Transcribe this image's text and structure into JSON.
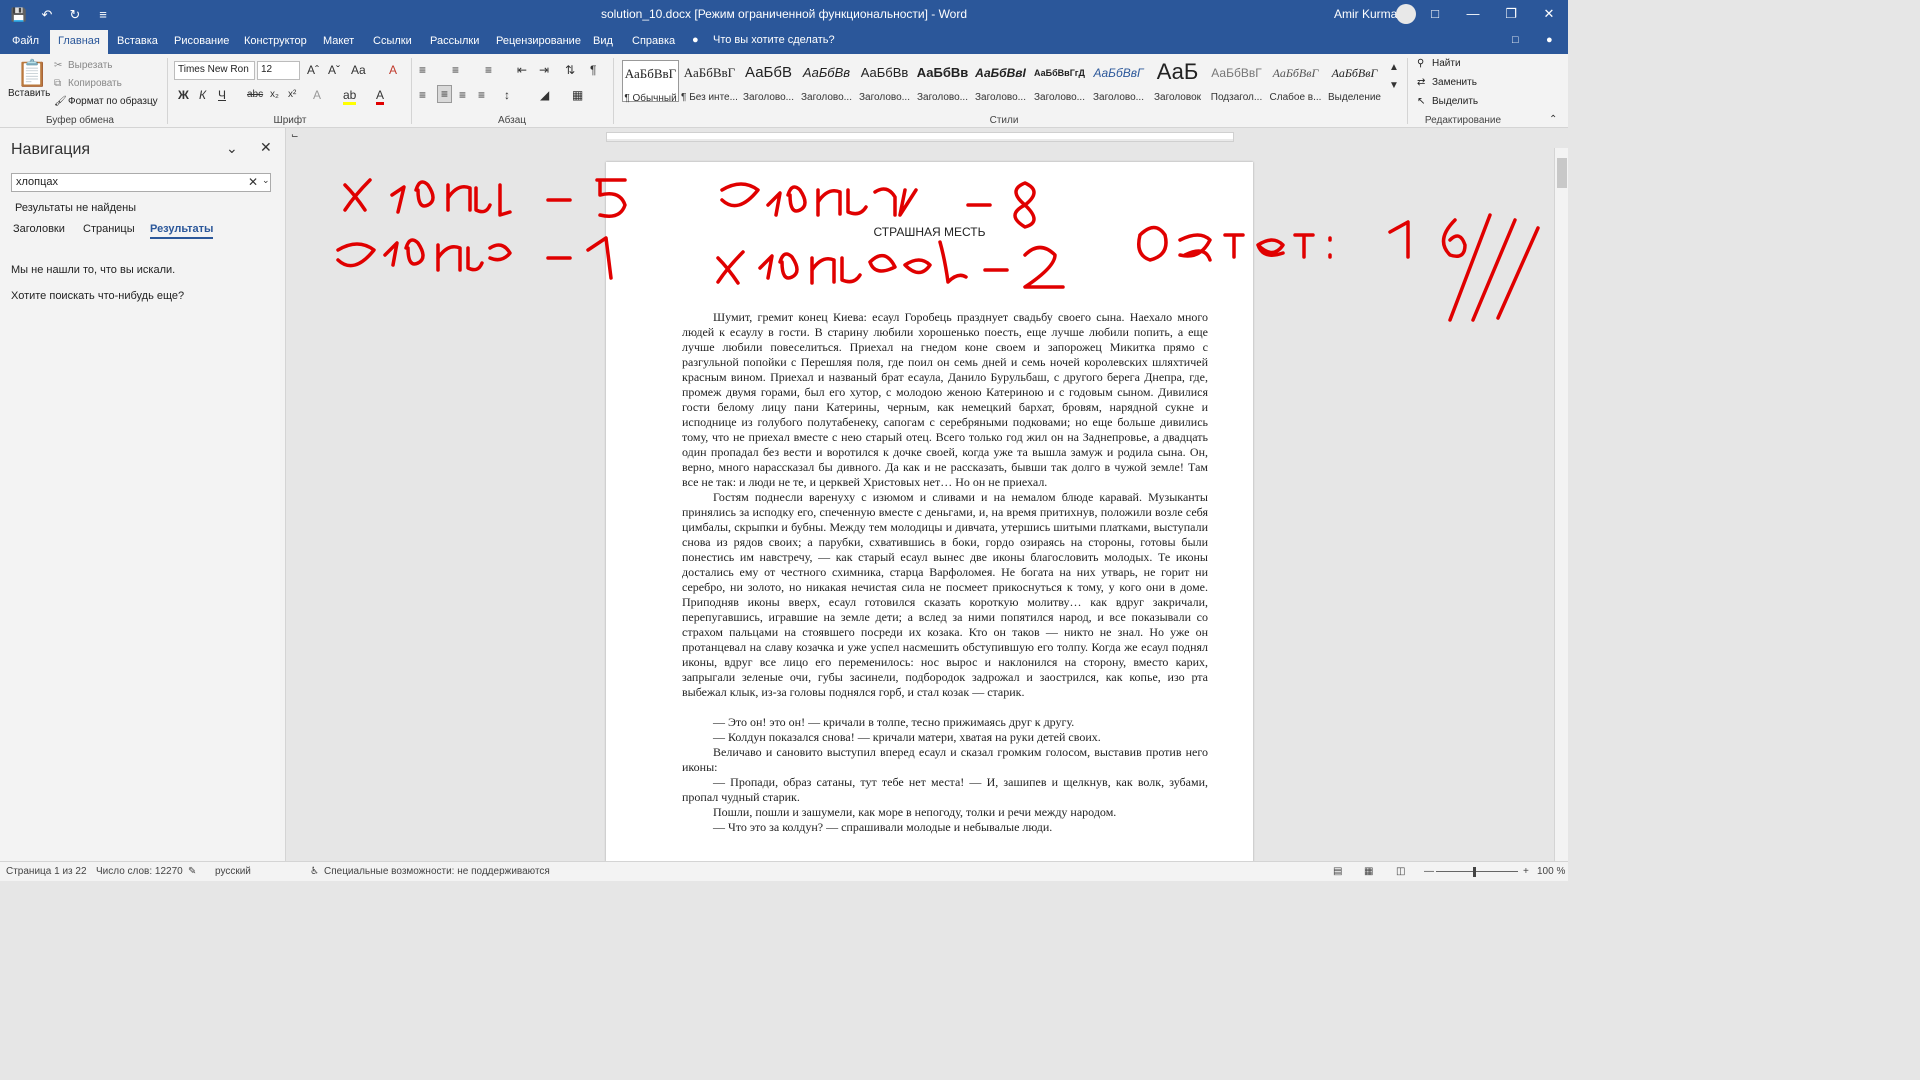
{
  "titlebar": {
    "title": "solution_10.docx [Режим ограниченной функциональности]  -  Word",
    "user": "Amir Kurmaev"
  },
  "tabs": [
    "Файл",
    "Главная",
    "Вставка",
    "Рисование",
    "Конструктор",
    "Макет",
    "Ссылки",
    "Рассылки",
    "Рецензирование",
    "Вид",
    "Справка"
  ],
  "tellme": "Что вы хотите сделать?",
  "ribbon": {
    "clipboard": {
      "paste": "Вставить",
      "cut": "Вырезать",
      "copy": "Копировать",
      "format_painter": "Формат по образцу",
      "label": "Буфер обмена"
    },
    "font": {
      "family": "Times New Ron",
      "size": "12",
      "label": "Шрифт"
    },
    "paragraph": {
      "label": "Абзац"
    },
    "styles": {
      "label": "Стили",
      "items": [
        {
          "sample": "АаБбВвГ",
          "name": "¶ Обычный"
        },
        {
          "sample": "АаБбВвГ",
          "name": "¶ Без инте..."
        },
        {
          "sample": "АаБбВ",
          "name": "Заголово..."
        },
        {
          "sample": "АаБбВв",
          "name": "Заголово..."
        },
        {
          "sample": "АаБбВв",
          "name": "Заголово..."
        },
        {
          "sample": "АаБбВв",
          "name": "Заголово..."
        },
        {
          "sample": "АаБбВвІ",
          "name": "Заголово..."
        },
        {
          "sample": "АаБбВвГгД",
          "name": "Заголово..."
        },
        {
          "sample": "АаБбВвГ",
          "name": "Заголово..."
        },
        {
          "sample": "АаБ",
          "name": "Заголовок"
        },
        {
          "sample": "АаБбВвГ",
          "name": "Подзагол..."
        },
        {
          "sample": "АаБбВвГ",
          "name": "Слабое в..."
        },
        {
          "sample": "АаБбВвГ",
          "name": "Выделение"
        }
      ]
    },
    "editing": {
      "find": "Найти",
      "replace": "Заменить",
      "select": "Выделить",
      "label": "Редактирование"
    }
  },
  "nav": {
    "title": "Навигация",
    "search_value": "хлопцах",
    "no_results": "Результаты не найдены",
    "tabs": [
      "Заголовки",
      "Страницы",
      "Результаты"
    ],
    "msg1": "Мы не нашли то, что вы искали.",
    "msg2": "Хотите поискать что-нибудь еще?"
  },
  "document": {
    "title": "СТРАШНАЯ МЕСТЬ",
    "paragraphs": [
      "Шумит, гремит конец Киева: есаул Горобець празднует свадьбу своего сына. Наехало много людей к есаулу в гости. В старину любили хорошенько поесть, еще лучше любили попить, а еще лучше любили повеселиться. Приехал на гнедом коне своем и запорожец Микитка прямо с разгульной попойки с Перешляя поля, где поил он семь дней и семь ночей королевских шляхтичей красным вином. Приехал и названый брат есаула, Данило Бурульбаш, с другого берега Днепра, где, промеж двумя горами, был его хутор, с молодою женою Катериною и с годовым сыном. Дивилися гости белому лицу пани Катерины, черным, как немецкий бархат, бровям, нарядной сукне и исподнице из голубого полутабенеку, сапогам с серебряными подковами; но еще больше дивились тому, что не приехал вместе с нею старый отец. Всего только год жил он на Заднепровье, а двадцать один пропадал без вести и воротился к дочке своей, когда уже та вышла замуж и родила сына. Он, верно, много нарассказал бы дивного. Да как и не рассказать, бывши так долго в чужой земле! Там все не так: и люди не те, и церквей Христовых нет… Но он не приехал.",
      "Гостям поднесли варенуху с изюмом и сливами и на немалом блюде каравай. Музыканты принялись за исподку его, спеченную вместе с деньгами, и, на время притихнув, положили возле себя цимбалы, скрыпки и бубны. Между тем молодицы и дивчата, утершись шитыми платками, выступали снова из рядов своих; а парубки, схватившись в боки, гордо озираясь на стороны, готовы были понестись им навстречу, — как старый есаул вынес две иконы благословить молодых. Те иконы достались ему от честного схимника, старца Варфоломея. Не богата на них утварь, не горит ни серебро, ни золото, но никакая нечистая сила не посмеет прикоснуться к тому, у кого они в доме. Приподняв иконы вверх, есаул готовился сказать короткую молитву… как вдруг закричали, перепугавшись, игравшие на земле дети; а вслед за ними попятился народ, и все показывали со страхом пальцами на стоявшего посреди их козака. Кто он таков — никто не знал. Но уже он протанцевал на славу козачка и уже успел насмешить обступившую его толпу. Когда же есаул поднял иконы, вдруг все лицо его переменилось: нос вырос и наклонился на сторону, вместо карих, запрыгали зеленые очи, губы засинели, подбородок задрожал и заострился, как копье, изо рта выбежал клык, из-за головы поднялся горб, и стал козак — старик.",
      "",
      "— Это он! это он! — кричали в толпе, тесно прижимаясь друг к другу.",
      "— Колдун показался снова! — кричали матери, хватая на руки детей своих.",
      "Величаво и сановито выступил вперед есаул и сказал громким голосом, выставив против него иконы:",
      "— Пропади, образ сатаны, тут тебе нет места! — И, зашипев и щелкнув, как волк, зубами, пропал чудный старик.",
      "Пошли, пошли и зашумели, как море в непогоду, толки и речи между народом.",
      "— Что это за колдун? — спрашивали молодые и небывалые люди."
    ]
  },
  "statusbar": {
    "page": "Страница 1 из 22",
    "words": "Число слов: 12270",
    "language": "русский",
    "accessibility": "Специальные возможности: не поддерживаются",
    "zoom": "100 %"
  },
  "handwriting": {
    "line1": "хлопц – 5",
    "line2": "хлопцам – 8",
    "line3": "хлопца – 1",
    "line4": "хлопцев – 2",
    "answer": "Ответ: 16",
    "ink_color": "#e00000"
  }
}
